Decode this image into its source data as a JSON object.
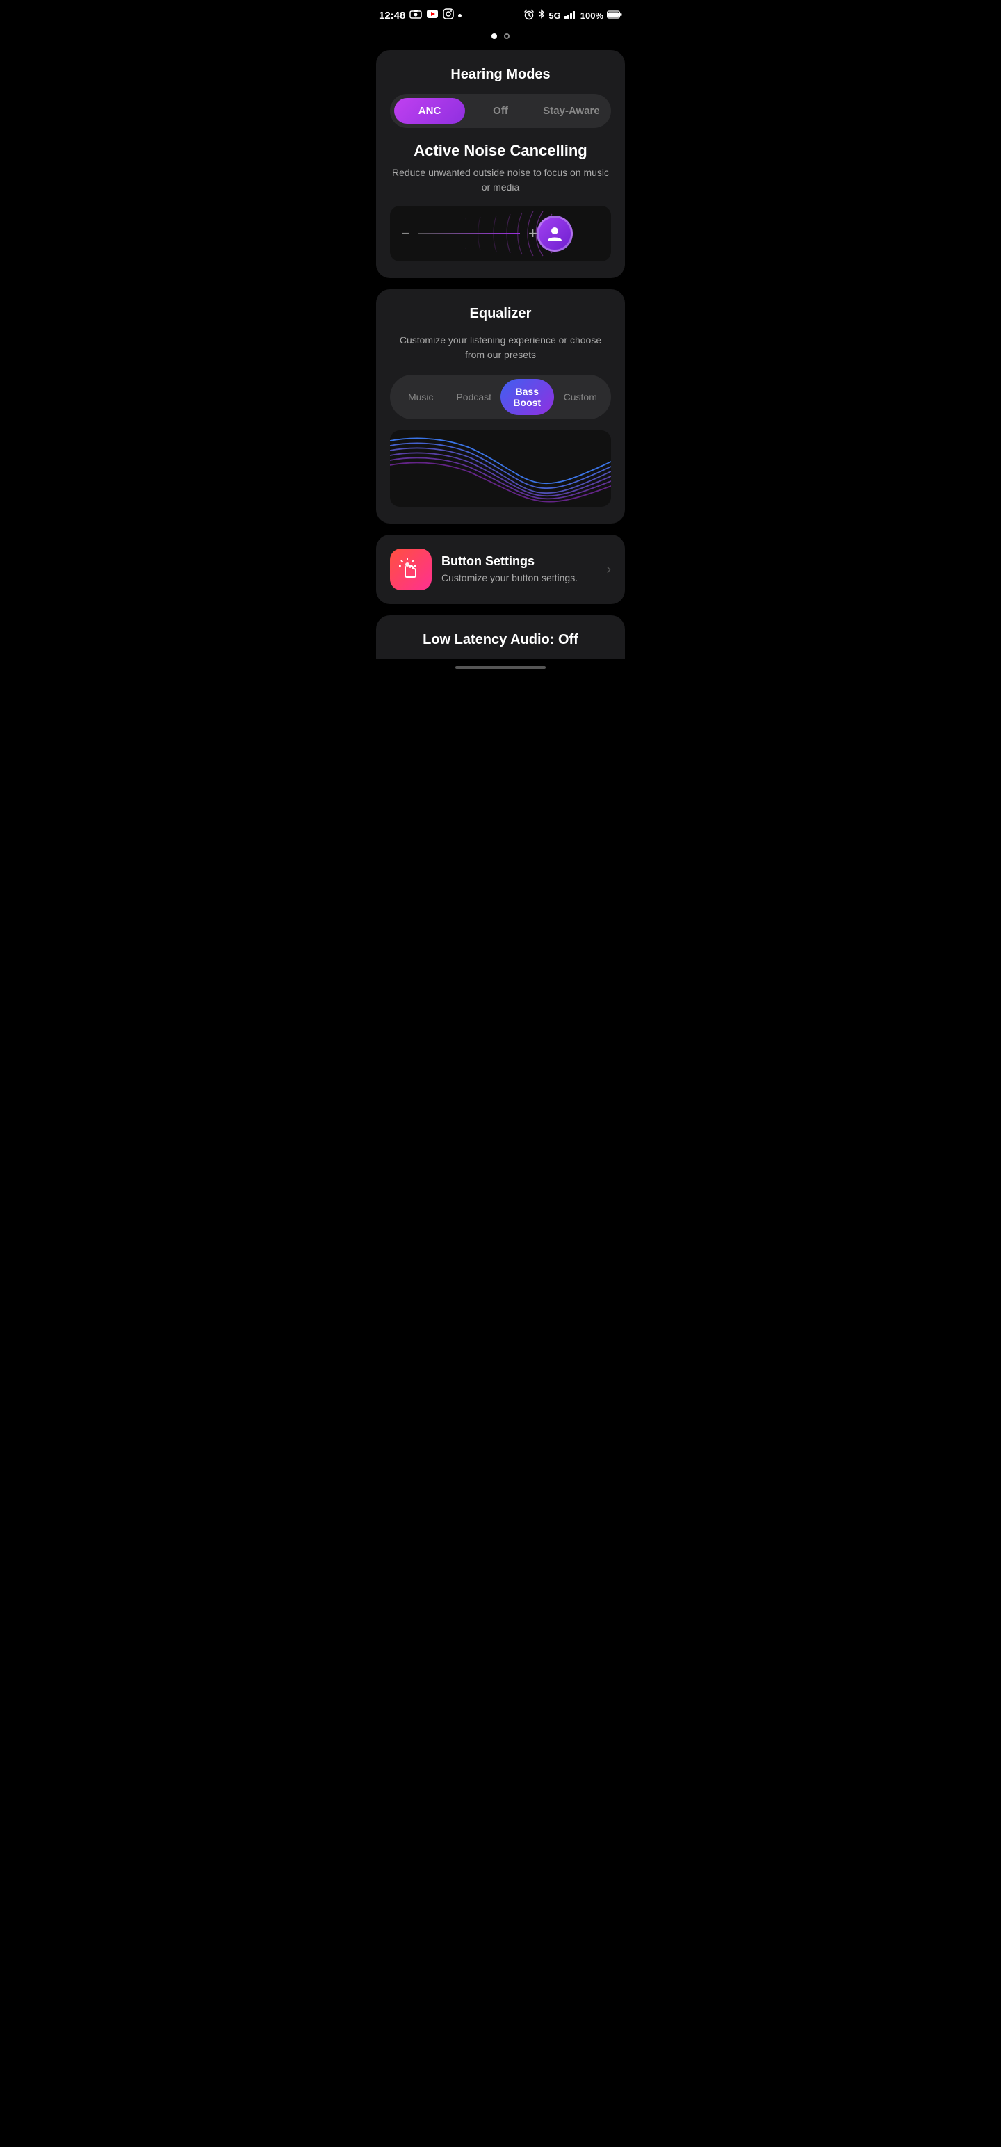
{
  "statusBar": {
    "time": "12:48",
    "battery": "100%",
    "signal": "5G"
  },
  "pageIndicators": [
    {
      "active": true
    },
    {
      "active": false
    }
  ],
  "hearingModes": {
    "title": "Hearing Modes",
    "modes": [
      {
        "label": "ANC",
        "active": true
      },
      {
        "label": "Off",
        "active": false
      },
      {
        "label": "Stay-Aware",
        "active": false
      }
    ],
    "activeMode": {
      "title": "Active Noise Cancelling",
      "description": "Reduce unwanted outside noise to focus on music or media"
    }
  },
  "equalizer": {
    "title": "Equalizer",
    "description": "Customize your listening experience or choose from our presets",
    "tabs": [
      {
        "label": "Music",
        "active": false
      },
      {
        "label": "Podcast",
        "active": false
      },
      {
        "label": "Bass Boost",
        "active": true
      },
      {
        "label": "Custom",
        "active": false
      }
    ]
  },
  "buttonSettings": {
    "title": "Button Settings",
    "description": "Customize your button settings."
  },
  "lowLatency": {
    "title": "Low Latency Audio: Off"
  },
  "icons": {
    "minus": "−",
    "plus": "+",
    "chevronRight": "›",
    "person": "person"
  }
}
